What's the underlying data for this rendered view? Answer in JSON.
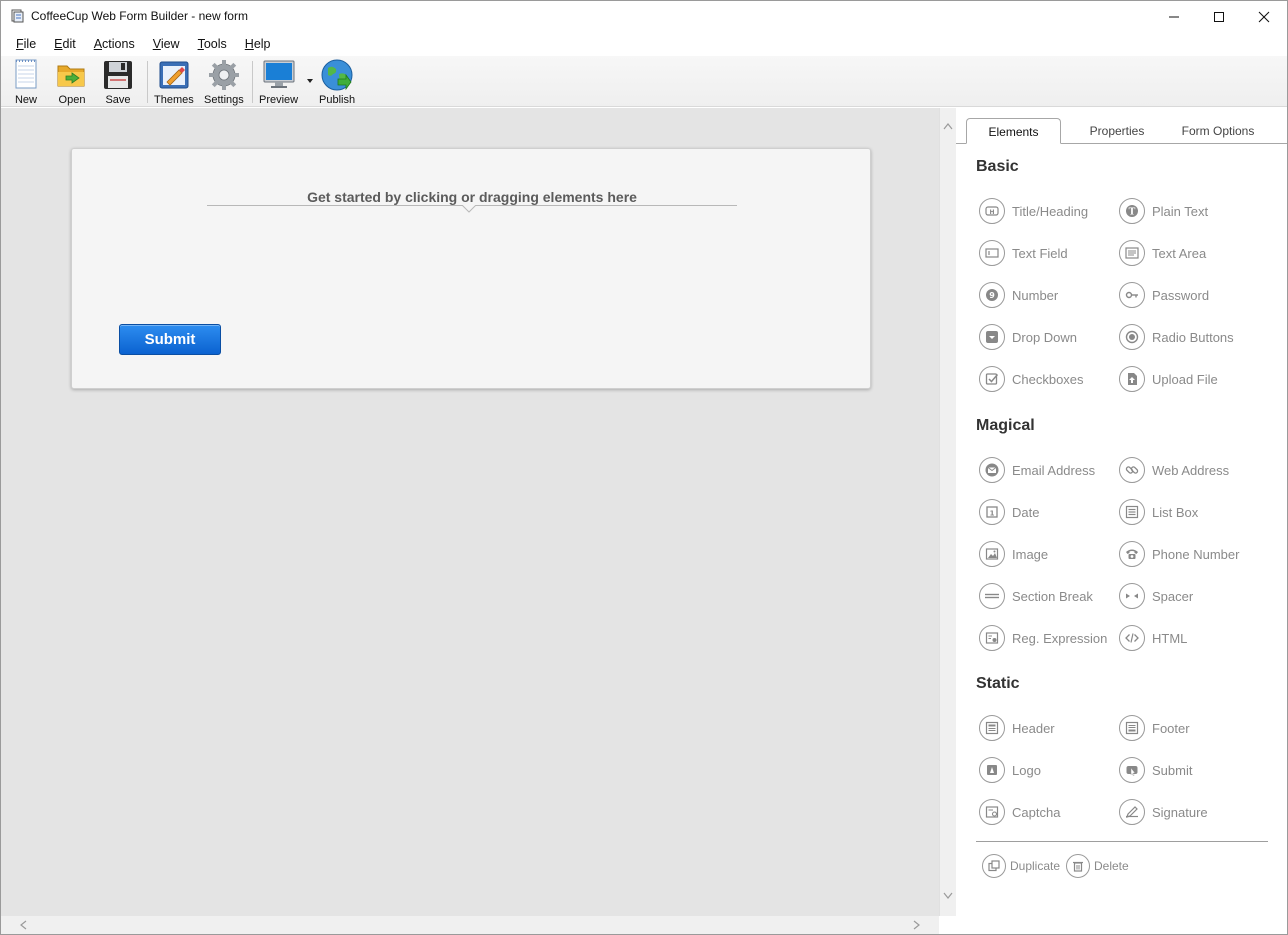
{
  "window": {
    "title": "CoffeeCup Web Form Builder - new form"
  },
  "menu": [
    {
      "label": "File",
      "key": "F",
      "rest": "ile"
    },
    {
      "label": "Edit",
      "key": "E",
      "rest": "dit"
    },
    {
      "label": "Actions",
      "key": "A",
      "rest": "ctions"
    },
    {
      "label": "View",
      "key": "V",
      "rest": "iew"
    },
    {
      "label": "Tools",
      "key": "T",
      "rest": "ools"
    },
    {
      "label": "Help",
      "key": "H",
      "rest": "elp"
    }
  ],
  "toolbar": {
    "new": "New",
    "open": "Open",
    "save": "Save",
    "themes": "Themes",
    "settings": "Settings",
    "preview": "Preview",
    "publish": "Publish"
  },
  "canvas": {
    "hint": "Get started by clicking or dragging elements here",
    "submit": "Submit"
  },
  "panel": {
    "tabs": {
      "elements": "Elements",
      "properties": "Properties",
      "form_options": "Form Options"
    },
    "basic_title": "Basic",
    "basic": [
      "Title/Heading",
      "Plain Text",
      "Text Field",
      "Text Area",
      "Number",
      "Password",
      "Drop Down",
      "Radio Buttons",
      "Checkboxes",
      "Upload File"
    ],
    "magical_title": "Magical",
    "magical": [
      "Email Address",
      "Web Address",
      "Date",
      "List Box",
      "Image",
      "Phone Number",
      "Section Break",
      "Spacer",
      "Reg. Expression",
      "HTML"
    ],
    "static_title": "Static",
    "static": [
      "Header",
      "Footer",
      "Logo",
      "Submit",
      "Captcha",
      "Signature"
    ],
    "actions": {
      "duplicate": "Duplicate",
      "delete": "Delete"
    }
  },
  "colors": {
    "accent": "#0b62d0",
    "canvas": "#e4e4e4",
    "muted_text": "#8a8a8a"
  }
}
